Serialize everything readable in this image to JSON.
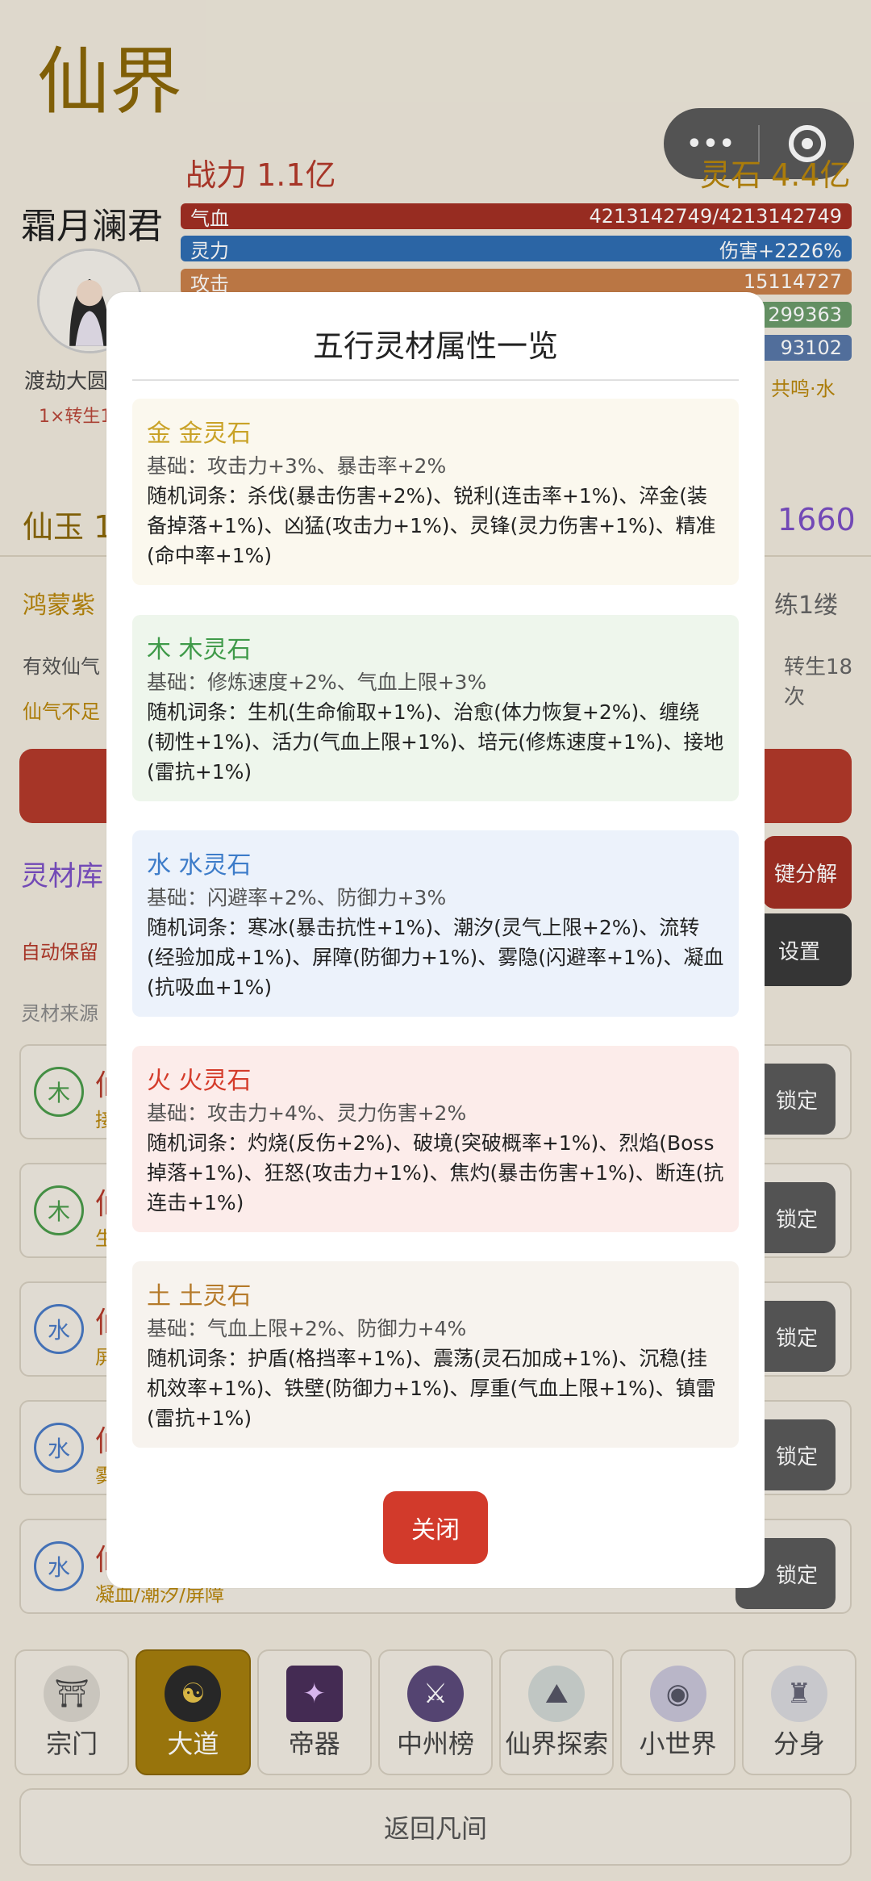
{
  "app_title": "仙界",
  "capsule": {
    "more": "•••"
  },
  "power": "战力 1.1亿",
  "lingshi_top": "灵石 4.4亿",
  "character": {
    "name": "霜月澜君",
    "realm": "渡劫大圆满",
    "rebirth": "1×转生18"
  },
  "bars": [
    {
      "label": "气血",
      "value": "4213142749/4213142749"
    },
    {
      "label": "灵力",
      "value": "伤害+2226%"
    },
    {
      "label": "攻击",
      "value": "15114727"
    },
    {
      "label": "",
      "value": "299363"
    },
    {
      "label": "",
      "value": "93102"
    }
  ],
  "gongming": "共鸣·水",
  "xianyu": "仙玉 1",
  "purple_num": "1660",
  "hongmeng": "鸿蒙紫",
  "lianlou": "练1缕",
  "youxiao": "有效仙气",
  "zhuansheng": "转生18次",
  "xianqi": "仙气不足",
  "lingcai": "灵材库",
  "yijian": "键分解",
  "zidong": "自动保留",
  "shezhi": "设置",
  "laiyuan": "灵材来源",
  "rows": [
    {
      "elem": "木",
      "color": "#4a9a4a",
      "title": "仙",
      "sub": "接",
      "lock": "锁定"
    },
    {
      "elem": "木",
      "color": "#4a9a4a",
      "title": "仙",
      "sub": "生",
      "lock": "锁定"
    },
    {
      "elem": "水",
      "color": "#4a7ac4",
      "title": "仙",
      "sub": "屏",
      "lock": "锁定"
    },
    {
      "elem": "水",
      "color": "#4a7ac4",
      "title": "仙",
      "sub": "雾",
      "lock": "锁定"
    },
    {
      "elem": "水",
      "color": "#4a7ac4",
      "title": "仙",
      "sub": "凝血/潮汐/屏障",
      "lock": "锁定"
    }
  ],
  "nav": [
    {
      "label": "宗门",
      "icon": "⛩"
    },
    {
      "label": "大道",
      "icon": "☯"
    },
    {
      "label": "帝器",
      "icon": "✦"
    },
    {
      "label": "中州榜",
      "icon": "⚔"
    },
    {
      "label": "仙界探索",
      "icon": "⛰"
    },
    {
      "label": "小世界",
      "icon": "◉"
    },
    {
      "label": "分身",
      "icon": "♜"
    }
  ],
  "back_label": "返回凡间",
  "modal": {
    "title": "五行灵材属性一览",
    "close_label": "关闭",
    "cards": [
      {
        "head": "金 金灵石",
        "color": "#c9a227",
        "bg": "#fbf8ee",
        "base": "基础：攻击力+3%、暴击率+2%",
        "random": "随机词条：杀伐(暴击伤害+2%)、锐利(连击率+1%)、淬金(装备掉落+1%)、凶猛(攻击力+1%)、灵锋(灵力伤害+1%)、精准(命中率+1%)"
      },
      {
        "head": "木 木灵石",
        "color": "#3f9a49",
        "bg": "#eef6ec",
        "base": "基础：修炼速度+2%、气血上限+3%",
        "random": "随机词条：生机(生命偷取+1%)、治愈(体力恢复+2%)、缠绕(韧性+1%)、活力(气血上限+1%)、培元(修炼速度+1%)、接地(雷抗+1%)"
      },
      {
        "head": "水 水灵石",
        "color": "#3d7cc9",
        "bg": "#ecf2fb",
        "base": "基础：闪避率+2%、防御力+3%",
        "random": "随机词条：寒冰(暴击抗性+1%)、潮汐(灵气上限+2%)、流转(经验加成+1%)、屏障(防御力+1%)、雾隐(闪避率+1%)、凝血(抗吸血+1%)"
      },
      {
        "head": "火 火灵石",
        "color": "#d43b2a",
        "bg": "#fcecea",
        "base": "基础：攻击力+4%、灵力伤害+2%",
        "random": "随机词条：灼烧(反伤+2%)、破境(突破概率+1%)、烈焰(Boss掉落+1%)、狂怒(攻击力+1%)、焦灼(暴击伤害+1%)、断连(抗连击+1%)"
      },
      {
        "head": "土 土灵石",
        "color": "#b57a2a",
        "bg": "#f7f3ee",
        "base": "基础：气血上限+2%、防御力+4%",
        "random": "随机词条：护盾(格挡率+1%)、震荡(灵石加成+1%)、沉稳(挂机效率+1%)、铁壁(防御力+1%)、厚重(气血上限+1%)、镇雷(雷抗+1%)"
      }
    ]
  }
}
